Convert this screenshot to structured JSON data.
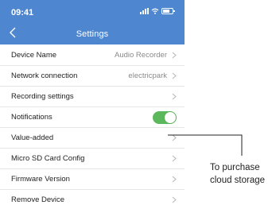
{
  "status_bar": {
    "time": "09:41"
  },
  "header": {
    "title": "Settings"
  },
  "settings": [
    {
      "label": "Device Name",
      "value": "Audio Recorder"
    },
    {
      "label": "Network connection",
      "value": "electricpark"
    },
    {
      "label": "Recording settings",
      "value": ""
    },
    {
      "label": "Notifications",
      "toggle": true
    },
    {
      "label": "Value-added",
      "value": ""
    },
    {
      "label": "Micro SD Card Config",
      "value": ""
    },
    {
      "label": "Firmware Version",
      "value": ""
    },
    {
      "label": "Remove Device",
      "value": ""
    }
  ],
  "callout": {
    "line1": "To purchase",
    "line2": "cloud storage"
  },
  "colors": {
    "header": "#4e86cf",
    "toggle_on": "#5cb85c"
  }
}
